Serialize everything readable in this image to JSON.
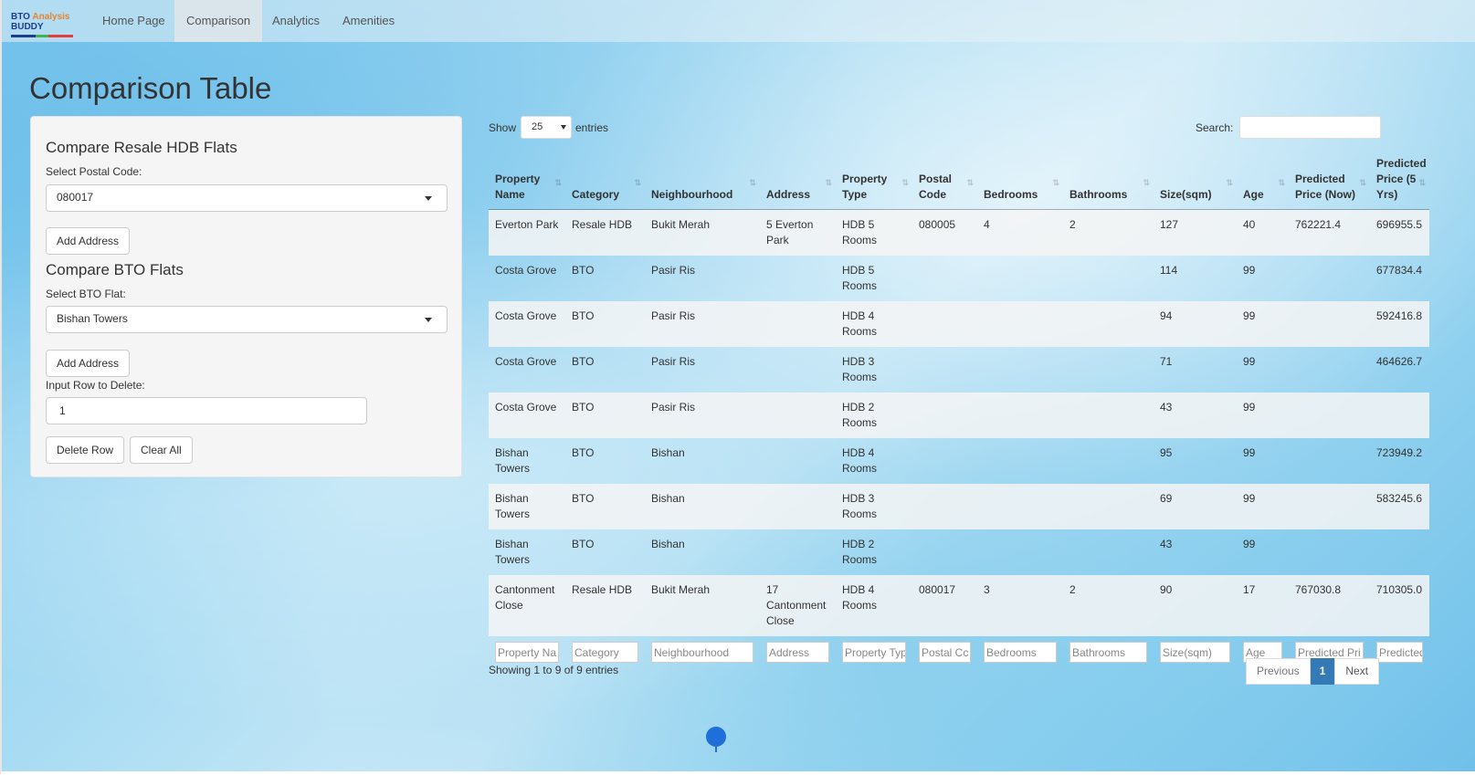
{
  "brand": {
    "line1_a": "BTO",
    "line1_b": "Analysis",
    "line2": "BUDDY"
  },
  "nav": [
    "Home Page",
    "Comparison",
    "Analytics",
    "Amenities"
  ],
  "page_title": "Comparison Table",
  "sidebar": {
    "resale_heading": "Compare Resale HDB Flats",
    "postal_label": "Select Postal Code:",
    "postal_value": "080017",
    "add_address_1": "Add Address",
    "bto_heading": "Compare BTO Flats",
    "bto_label": "Select BTO Flat:",
    "bto_value": "Bishan Towers",
    "add_address_2": "Add Address",
    "delete_label": "Input Row to Delete:",
    "delete_value": "1",
    "delete_button": "Delete Row",
    "clear_button": "Clear All"
  },
  "table_controls": {
    "show": "Show",
    "length": "25",
    "entries": "entries",
    "search_label": "Search:"
  },
  "columns": [
    "Property Name",
    "Category",
    "Neighbourhood",
    "Address",
    "Property Type",
    "Postal Code",
    "Bedrooms",
    "Bathrooms",
    "Size(sqm)",
    "Age",
    "Predicted Price (Now)",
    "Predicted Price (5 Yrs)"
  ],
  "rows": [
    [
      "Everton Park",
      "Resale HDB",
      "Bukit Merah",
      "5 Everton Park",
      "HDB 5 Rooms",
      "080005",
      "4",
      "2",
      "127",
      "40",
      "762221.4",
      "696955.5"
    ],
    [
      "Costa Grove",
      "BTO",
      "Pasir Ris",
      "",
      "HDB 5 Rooms",
      "",
      "",
      "",
      "114",
      "99",
      "",
      "677834.4"
    ],
    [
      "Costa Grove",
      "BTO",
      "Pasir Ris",
      "",
      "HDB 4 Rooms",
      "",
      "",
      "",
      "94",
      "99",
      "",
      "592416.8"
    ],
    [
      "Costa Grove",
      "BTO",
      "Pasir Ris",
      "",
      "HDB 3 Rooms",
      "",
      "",
      "",
      "71",
      "99",
      "",
      "464626.7"
    ],
    [
      "Costa Grove",
      "BTO",
      "Pasir Ris",
      "",
      "HDB 2 Rooms",
      "",
      "",
      "",
      "43",
      "99",
      "",
      ""
    ],
    [
      "Bishan Towers",
      "BTO",
      "Bishan",
      "",
      "HDB 4 Rooms",
      "",
      "",
      "",
      "95",
      "99",
      "",
      "723949.2"
    ],
    [
      "Bishan Towers",
      "BTO",
      "Bishan",
      "",
      "HDB 3 Rooms",
      "",
      "",
      "",
      "69",
      "99",
      "",
      "583245.6"
    ],
    [
      "Bishan Towers",
      "BTO",
      "Bishan",
      "",
      "HDB 2 Rooms",
      "",
      "",
      "",
      "43",
      "99",
      "",
      ""
    ],
    [
      "Cantonment Close",
      "Resale HDB",
      "Bukit Merah",
      "17 Cantonment Close",
      "HDB 4 Rooms",
      "080017",
      "3",
      "2",
      "90",
      "17",
      "767030.8",
      "710305.0"
    ]
  ],
  "filters": [
    "Property Na",
    "Category",
    "Neighbourhood",
    "Address",
    "Property Typ",
    "Postal Cc",
    "Bedrooms",
    "Bathrooms",
    "Size(sqm)",
    "Age",
    "Predicted Pri",
    "Predicted"
  ],
  "info": "Showing 1 to 9 of 9 entries",
  "pager": {
    "prev": "Previous",
    "current": "1",
    "next": "Next"
  },
  "colors": {
    "accent": "#337ab7",
    "cursor": "#1e6fd9"
  }
}
